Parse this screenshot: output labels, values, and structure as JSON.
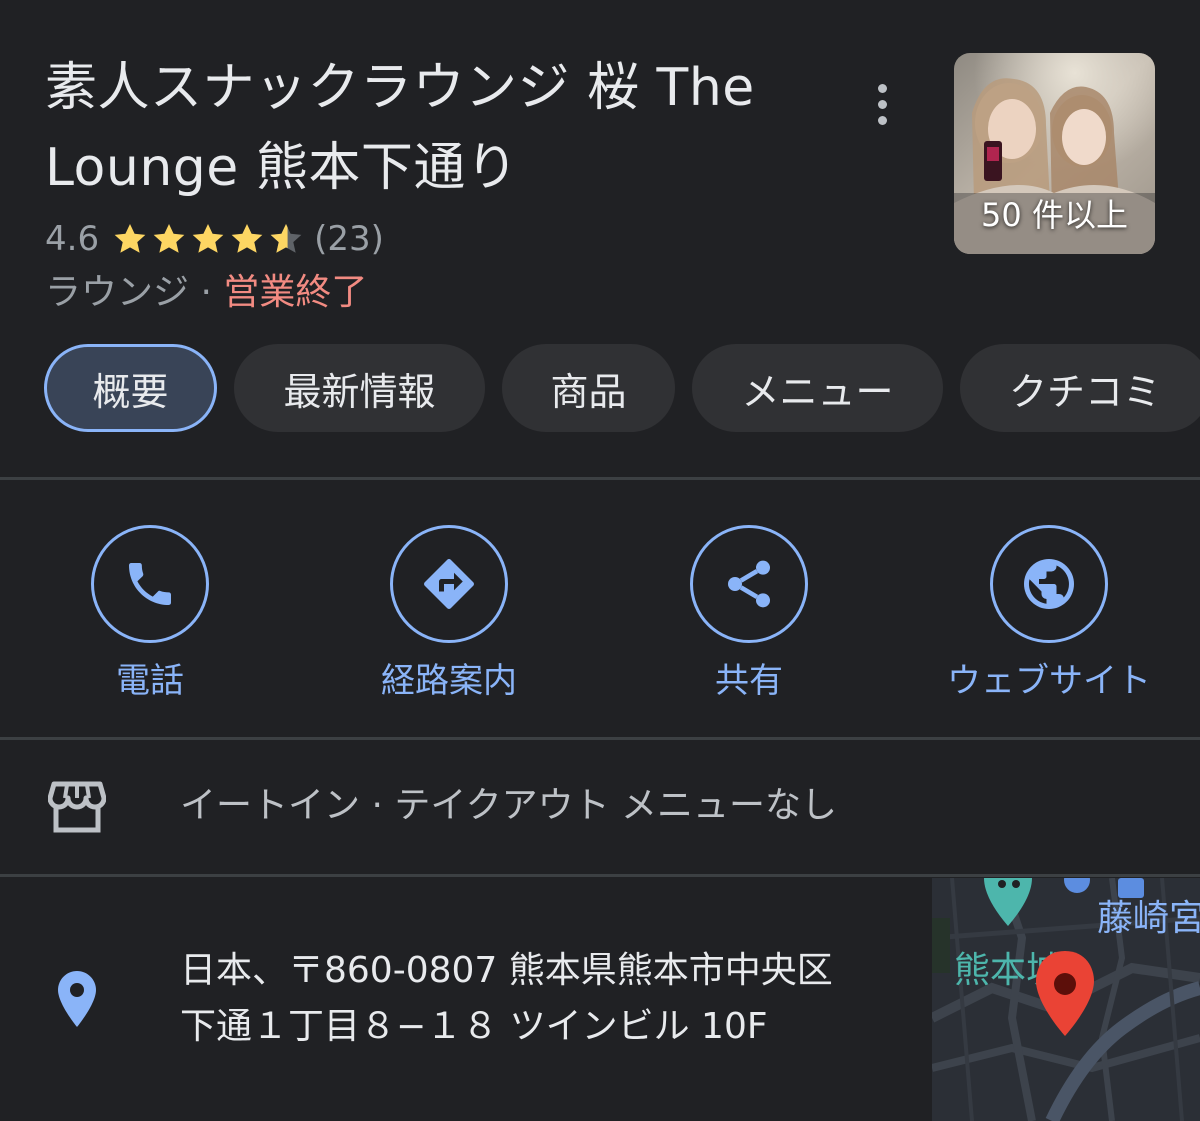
{
  "place": {
    "title_line1": "素人スナックラウンジ 桜 The",
    "title_line2": "Lounge 熊本下通り",
    "rating": "4.6",
    "review_count": "(23)",
    "category": "ラウンジ",
    "separator": " · ",
    "status": "営業終了",
    "star_rating_value": 4.6
  },
  "photos": {
    "count_label": "50 件以上"
  },
  "tabs": [
    {
      "label": "概要"
    },
    {
      "label": "最新情報"
    },
    {
      "label": "商品"
    },
    {
      "label": "メニュー"
    },
    {
      "label": "クチコミ"
    }
  ],
  "actions": [
    {
      "label": "電話",
      "icon": "phone-icon"
    },
    {
      "label": "経路案内",
      "icon": "directions-icon"
    },
    {
      "label": "共有",
      "icon": "share-icon"
    },
    {
      "label": "ウェブサイト",
      "icon": "globe-icon"
    }
  ],
  "service_options": {
    "text": "イートイン · テイクアウト メニューなし",
    "icon": "storefront-icon"
  },
  "address": {
    "line1": "日本、〒860-0807 熊本県熊本市中央区",
    "line2": "下通１丁目８−１８ ツインビル 10F",
    "icon": "location-pin-icon"
  },
  "map": {
    "label_shrine": "藤崎宮",
    "label_castle": "熊本城"
  },
  "colors": {
    "background": "#202124",
    "accent": "#8ab4f8",
    "closed": "#f28b82",
    "star": "#fdd663",
    "secondary_text": "#9aa0a6"
  }
}
